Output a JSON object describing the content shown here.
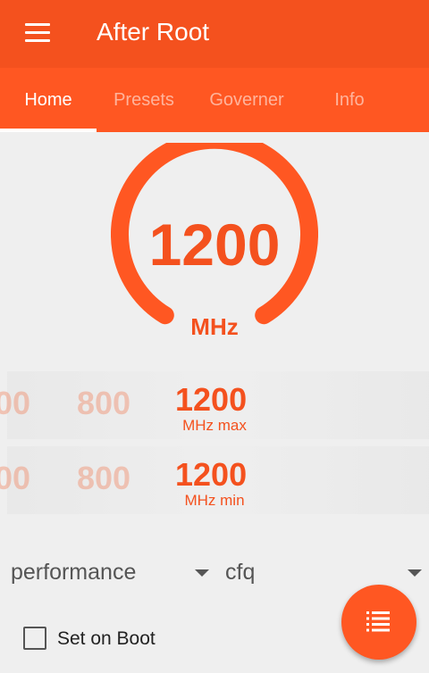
{
  "app": {
    "title": "After Root"
  },
  "tabs": [
    {
      "label": "Home",
      "active": true
    },
    {
      "label": "Presets",
      "active": false
    },
    {
      "label": "Governer",
      "active": false
    },
    {
      "label": "Info",
      "active": false
    }
  ],
  "gauge": {
    "value": "1200",
    "unit": "MHz"
  },
  "max_picker": {
    "values": [
      "00",
      "800",
      "1200"
    ],
    "selected": "1200",
    "label": "MHz max"
  },
  "min_picker": {
    "values": [
      "00",
      "800",
      "1200"
    ],
    "selected": "1200",
    "label": "MHz min"
  },
  "governor_select": {
    "value": "performance"
  },
  "scheduler_select": {
    "value": "cfq"
  },
  "set_on_boot": {
    "label": "Set on Boot",
    "checked": false
  },
  "colors": {
    "accent": "#f4511e",
    "tab_bar": "#ff5722",
    "background": "#efefef"
  },
  "icons": {
    "menu": "hamburger-menu-icon",
    "fab": "list-icon"
  }
}
